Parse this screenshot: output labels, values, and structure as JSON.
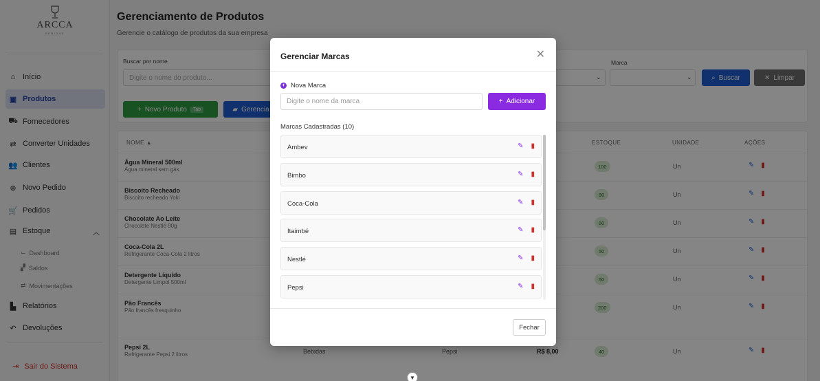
{
  "brand": {
    "name": "ARCCA",
    "sub": "BEBIDAS"
  },
  "sidebar": {
    "items": [
      {
        "label": "Início",
        "icon": "home-icon"
      },
      {
        "label": "Produtos",
        "icon": "box-icon"
      },
      {
        "label": "Fornecedores",
        "icon": "truck-icon"
      },
      {
        "label": "Converter Unidades",
        "icon": "swap-icon"
      },
      {
        "label": "Clientes",
        "icon": "users-icon"
      },
      {
        "label": "Novo Pedido",
        "icon": "plus-circle-icon"
      },
      {
        "label": "Pedidos",
        "icon": "cart-icon"
      },
      {
        "label": "Estoque",
        "icon": "warehouse-icon"
      }
    ],
    "sub_items": [
      {
        "label": "Dashboard",
        "icon": "chart-line-icon"
      },
      {
        "label": "Saldos",
        "icon": "boxes-icon"
      },
      {
        "label": "Movimentações",
        "icon": "exchange-icon"
      }
    ],
    "bottom_items": [
      {
        "label": "Relatórios",
        "icon": "report-icon"
      },
      {
        "label": "Devoluções",
        "icon": "undo-icon"
      }
    ],
    "logout": "Sair do Sistema"
  },
  "page": {
    "title": "Gerenciamento de Produtos",
    "subtitle": "Gerencie o catálogo de produtos da sua empresa"
  },
  "filters": {
    "search_label": "Buscar por nome",
    "search_placeholder": "Digite o nome do produto...",
    "brand_label": "Marca",
    "search_button": "Buscar",
    "clear_button": "Limpar",
    "new_product_button": "Novo Produto",
    "new_product_shortcut": "Tab",
    "manage_button": "Gerencia"
  },
  "table": {
    "headers": {
      "name": "NOME ▲",
      "stock": "ESTOQUE",
      "unit": "UNIDADE",
      "actions": "AÇÕES"
    },
    "rows": [
      {
        "name": "Água Mineral 500ml",
        "desc": "Água mineral sem gás",
        "category": "",
        "brand": "",
        "price": "",
        "stock": "100",
        "unit": "Un"
      },
      {
        "name": "Biscoito Recheado",
        "desc": "Biscoito recheado Yoki",
        "category": "",
        "brand": "",
        "price": "",
        "stock": "80",
        "unit": "Un"
      },
      {
        "name": "Chocolate Ao Leite",
        "desc": "Chocolate Nestlé 90g",
        "category": "",
        "brand": "",
        "price": "",
        "stock": "60",
        "unit": "Un"
      },
      {
        "name": "Coca-Cola 2L",
        "desc": "Refrigerante Coca-Cola 2 litros",
        "category": "",
        "brand": "",
        "price": "",
        "stock": "50",
        "unit": "Un"
      },
      {
        "name": "Detergente Líquido",
        "desc": "Detergente Limpol 500ml",
        "category": "",
        "brand": "",
        "price": "",
        "stock": "50",
        "unit": "Un"
      },
      {
        "name": "Pão Francês",
        "desc": "Pão francês fresquinho",
        "category": "",
        "brand": "",
        "price": "",
        "stock": "200",
        "unit": "Un"
      },
      {
        "name": "Pepsi 2L",
        "desc": "Refrigerante Pepsi 2 litros",
        "category": "Bebidas",
        "brand": "Pepsi",
        "price": "R$ 8,00",
        "stock": "40",
        "unit": "Un"
      }
    ]
  },
  "modal": {
    "title": "Gerenciar Marcas",
    "new_label": "Nova Marca",
    "input_placeholder": "Digite o nome da marca",
    "add_button": "Adicionar",
    "list_label": "Marcas Cadastradas (10)",
    "brands": [
      "Ambev",
      "Bimbo",
      "Coca-Cola",
      "Itaimbé",
      "Nestlé",
      "Pepsi"
    ],
    "close_button": "Fechar"
  },
  "colors": {
    "accent_purple": "#8a2be2",
    "primary_blue": "#1f5fd1",
    "success_green": "#2f9e44",
    "danger_red": "#d0312d"
  }
}
